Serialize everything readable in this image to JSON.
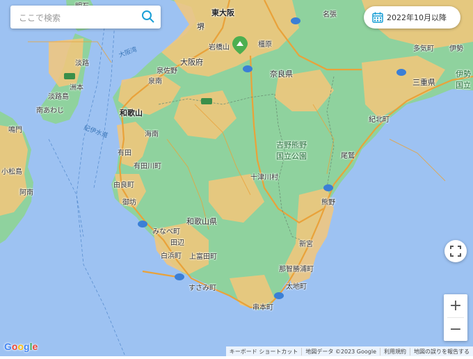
{
  "search": {
    "placeholder": "ここで検索"
  },
  "date_filter": {
    "label": "2022年10月以降"
  },
  "zoom": {
    "in": "+",
    "out": "−"
  },
  "logo": "Google",
  "attribution": [
    "キーボード ショートカット",
    "地図データ ©2023 Google",
    "利用規約",
    "地図の誤りを報告する"
  ],
  "colors": {
    "sea": "#9dc2f2",
    "land": "#8fd29e",
    "urban": "#f5c77a",
    "road": "#e9a23a",
    "accent": "#1a9fd6",
    "pin": "#4caf50"
  },
  "labels": {
    "higashiosaka": "東大阪",
    "sakai": "堺",
    "iwahashiyama": "岩橋山",
    "kashihara": "橿原",
    "nabari": "名張",
    "osakafu": "大阪府",
    "izumisano": "泉佐野",
    "izumi": "泉南",
    "naraken": "奈良県",
    "awaji": "淡路",
    "sumoto": "洲本",
    "awajishima": "淡路島",
    "minamiawaji": "南あわじ",
    "wakayama": "和歌山",
    "kainan": "海南",
    "arida": "有田",
    "aridagawa": "有田川町",
    "yuasa": "由良町",
    "gobo": "御坊",
    "minabe": "みなべ町",
    "tanabe": "田辺",
    "shirahama": "白浜町",
    "kamitonda": "上富田町",
    "susami": "すさみ町",
    "kushimoto": "串本町",
    "totsukawa": "十津川村",
    "yoshino_park": "吉野熊野\n国立公園",
    "owase": "尾鷲",
    "kumano": "熊野",
    "shingu": "新宮",
    "nachikatsuura": "那智勝浦町",
    "taiji": "太地町",
    "kihoku": "紀北町",
    "mieken": "三重県",
    "taki": "多気町",
    "ise": "伊勢",
    "ise_park": "伊勢\n国立",
    "wakayamaken": "和歌山県",
    "naruto": "鳴門",
    "komatsushima": "小松島",
    "anan": "阿南",
    "osakawan": "大阪湾",
    "kitan_strait": "紀伊水道",
    "nishinomiya": "明石"
  }
}
